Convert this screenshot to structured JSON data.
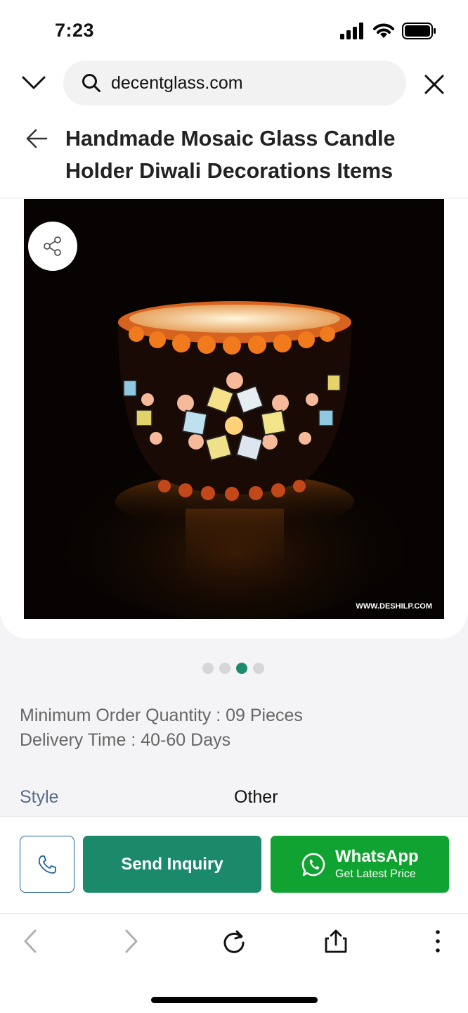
{
  "status_bar": {
    "time": "7:23"
  },
  "browser": {
    "url": "decentglass.com",
    "icons": [
      "chevron-down-icon",
      "search-icon",
      "close-icon"
    ]
  },
  "header": {
    "title": "Handmade Mosaic Glass Candle Holder Diwali Decorations Items"
  },
  "gallery": {
    "watermark": "WWW.DESHILP.COM",
    "slide_count": 4,
    "active_slide": 3
  },
  "details": {
    "min_order": "Minimum Order Quantity : 09 Pieces",
    "delivery": "Delivery Time : 40-60 Days",
    "specs": [
      {
        "label": "Style",
        "value": "Other"
      }
    ]
  },
  "actions": {
    "send_inquiry": "Send Inquiry",
    "whatsapp_title": "WhatsApp",
    "whatsapp_sub": "Get Latest Price"
  },
  "colors": {
    "inquiry_green": "#1b8a6b",
    "whatsapp_green": "#11a331",
    "active_dot": "#1d8a6f",
    "call_border": "#1e5f9c"
  }
}
